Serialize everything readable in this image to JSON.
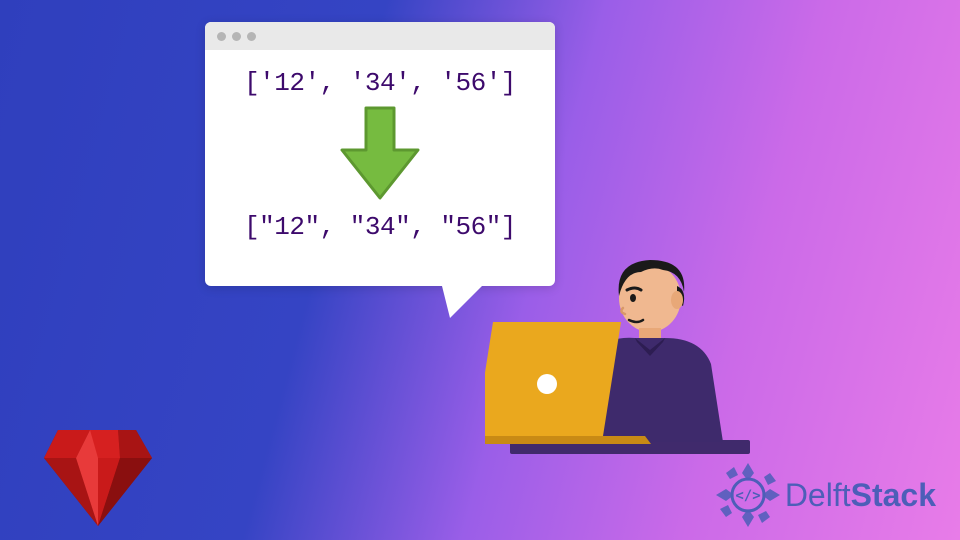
{
  "bubble": {
    "line1": "['12', '34', '56']",
    "line2": "[\"12\", \"34\", \"56\"]"
  },
  "logo": {
    "text_regular": "Delft",
    "text_bold": "Stack"
  },
  "colors": {
    "code_text": "#3d0a6c",
    "arrow_fill": "#76bb40",
    "arrow_stroke": "#5d9830",
    "ruby_dark": "#8a0f0f",
    "ruby_mid": "#c91a1a",
    "ruby_light": "#e83a3a",
    "person_skin": "#f0b890",
    "person_hair": "#1a1a1a",
    "person_shirt": "#3e2a6c",
    "laptop": "#eaa81e",
    "laptop_dark": "#c88a15",
    "logo_blue": "#4d5eb8"
  }
}
